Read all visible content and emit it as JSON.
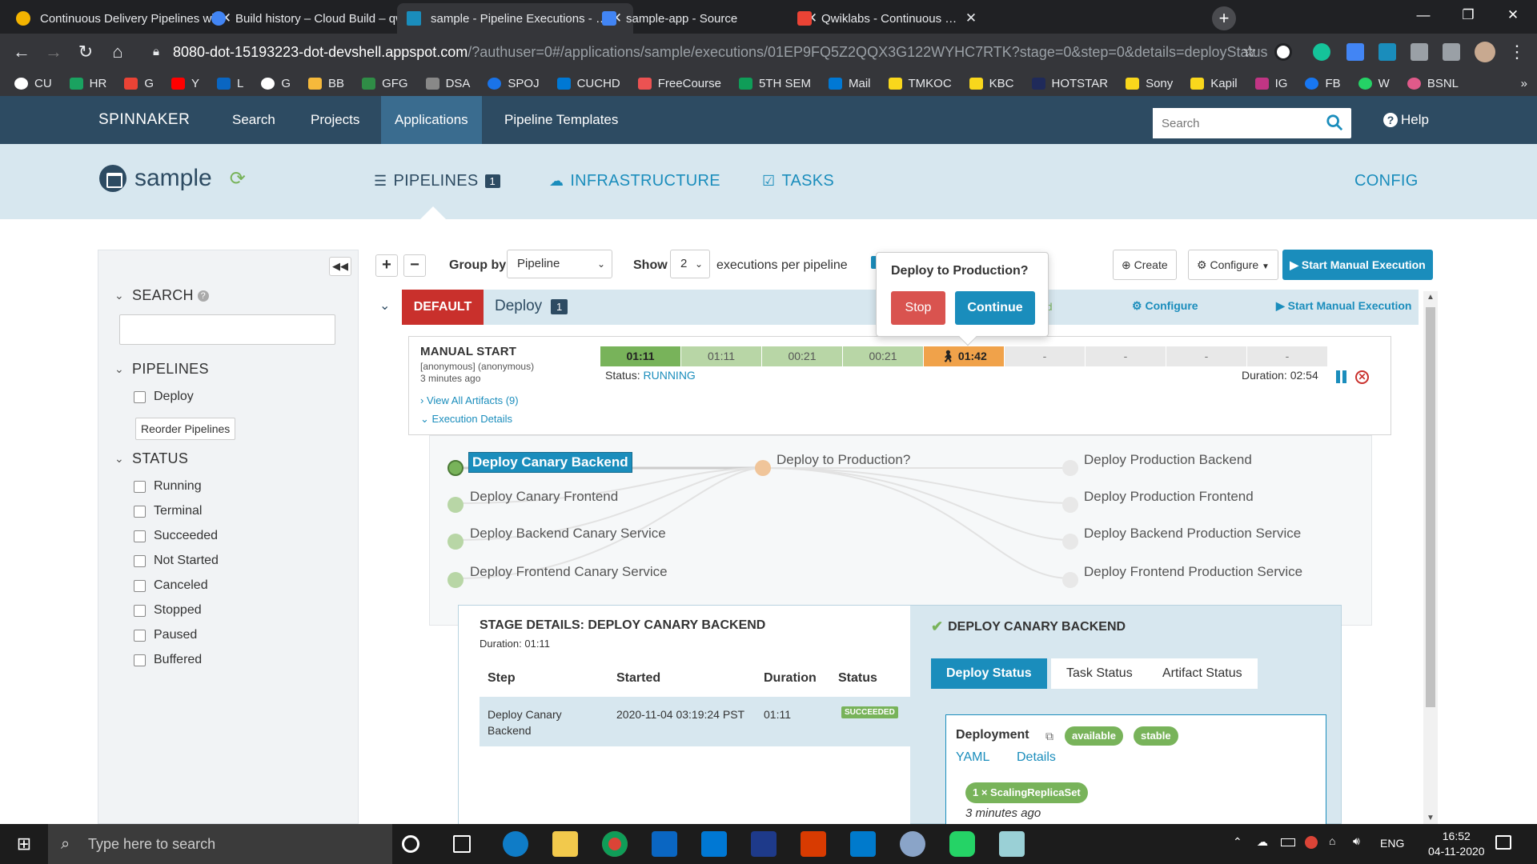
{
  "browser": {
    "tabs": [
      {
        "label": "Continuous Delivery Pipelines wi",
        "color": "#f4b400"
      },
      {
        "label": "Build history – Cloud Build – qwi",
        "color": "#4285f4"
      },
      {
        "label": "sample - Pipeline Executions - Ex",
        "color": "#1a8dbc"
      },
      {
        "label": "sample-app - Source",
        "color": "#4285f4"
      },
      {
        "label": "Qwiklabs - Continuous Delivery",
        "color": "#ea4335"
      }
    ],
    "url_host": "8080-dot-15193223-dot-devshell.appspot.com",
    "url_path": "/?authuser=0#/applications/sample/executions/01EP9FQ5Z2QQX3G122WYHC7RTK?stage=0&step=0&details=deployStatus",
    "bookmarks": [
      "CU",
      "HR",
      "G",
      "Y",
      "L",
      "G",
      "BB",
      "GFG",
      "DSA",
      "SPOJ",
      "CUCHD",
      "FreeCourse",
      "5TH SEM",
      "Mail",
      "TMKOC",
      "KBC",
      "HOTSTAR",
      "Sony",
      "Kapil",
      "IG",
      "FB",
      "W",
      "BSNL"
    ]
  },
  "header": {
    "brand": "SPINNAKER",
    "nav": [
      "Search",
      "Projects",
      "Applications",
      "Pipeline Templates"
    ],
    "search_placeholder": "Search",
    "help": "Help"
  },
  "app": {
    "name": "sample",
    "nav": {
      "pipelines": "PIPELINES",
      "pipelines_count": "1",
      "infrastructure": "INFRASTRUCTURE",
      "tasks": "TASKS",
      "config": "CONFIG"
    }
  },
  "sidebar": {
    "search_label": "SEARCH",
    "pipelines_label": "PIPELINES",
    "pipelines": [
      "Deploy"
    ],
    "reorder": "Reorder Pipelines",
    "status_label": "STATUS",
    "statuses": [
      "Running",
      "Terminal",
      "Succeeded",
      "Not Started",
      "Canceled",
      "Stopped",
      "Paused",
      "Buffered"
    ]
  },
  "toolbar": {
    "group_by_label": "Group by",
    "group_by_value": "Pipeline",
    "show_label": "Show",
    "show_value": "2",
    "per_pipeline": "executions per pipeline",
    "create": "Create",
    "configure": "Configure",
    "start_manual": "Start Manual Execution"
  },
  "group": {
    "tag": "DEFAULT",
    "title": "Deploy",
    "count": "1",
    "status_partial": "ed",
    "configure": "Configure",
    "start_manual": "Start Manual Execution"
  },
  "execution": {
    "trigger": "MANUAL START",
    "user": "[anonymous] (anonymous)",
    "ago": "3 minutes ago",
    "artifacts": "View All Artifacts (9)",
    "details": "Execution Details",
    "stages": [
      {
        "label": "01:11",
        "color": "#78b35a",
        "text": "#222",
        "bold": true
      },
      {
        "label": "01:11",
        "color": "#b8d6a6",
        "text": "#555",
        "bold": false
      },
      {
        "label": "00:21",
        "color": "#b8d6a6",
        "text": "#555",
        "bold": false
      },
      {
        "label": "00:21",
        "color": "#b8d6a6",
        "text": "#555",
        "bold": false
      },
      {
        "label": "01:42",
        "color": "#f0a24a",
        "text": "#222",
        "bold": true
      },
      {
        "label": "-",
        "color": "#e8e8e8",
        "text": "#777",
        "bold": false
      },
      {
        "label": "-",
        "color": "#e8e8e8",
        "text": "#777",
        "bold": false
      },
      {
        "label": "-",
        "color": "#e8e8e8",
        "text": "#777",
        "bold": false
      },
      {
        "label": "-",
        "color": "#e8e8e8",
        "text": "#777",
        "bold": false
      }
    ],
    "status_label": "Status:",
    "status": "RUNNING",
    "duration": "Duration: 02:54"
  },
  "graph": {
    "canary": [
      "Deploy Canary Backend",
      "Deploy Canary Frontend",
      "Deploy Backend Canary Service",
      "Deploy Frontend Canary Service"
    ],
    "manual": "Deploy to Production?",
    "production": [
      "Deploy Production Backend",
      "Deploy Production Frontend",
      "Deploy Backend Production Service",
      "Deploy Frontend Production Service"
    ]
  },
  "popover": {
    "title": "Deploy to Production?",
    "stop": "Stop",
    "continue": "Continue"
  },
  "stage_details": {
    "title": "STAGE DETAILS: DEPLOY CANARY BACKEND",
    "duration": "Duration: 01:11",
    "columns": [
      "Step",
      "Started",
      "Duration",
      "Status"
    ],
    "row": {
      "step_line1": "Deploy Canary",
      "step_line2": "Backend",
      "started": "2020-11-04 03:19:24 PST",
      "duration": "01:11",
      "status": "SUCCEEDED"
    },
    "right_title": "DEPLOY CANARY BACKEND",
    "tabs": [
      "Deploy Status",
      "Task Status",
      "Artifact Status"
    ],
    "deployment_label": "Deployment",
    "pills": [
      "available",
      "stable"
    ],
    "links": [
      "YAML",
      "Details"
    ],
    "replicaset": "1 × ScalingReplicaSet",
    "replicaset_ago": "3 minutes ago"
  },
  "taskbar": {
    "search_placeholder": "Type here to search",
    "lang": "ENG",
    "time": "16:52",
    "date": "04-11-2020"
  }
}
